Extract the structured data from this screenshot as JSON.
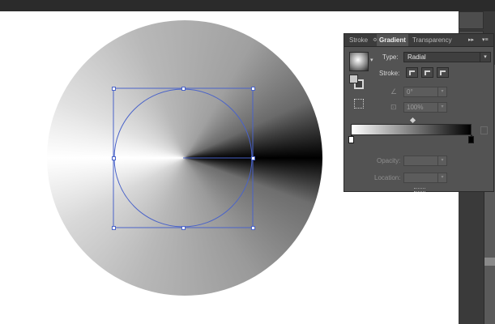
{
  "panel": {
    "tabs": [
      {
        "label": "Stroke"
      },
      {
        "label": "Gradient"
      },
      {
        "label": "Transparency"
      }
    ],
    "tab_double_arrow": "≎",
    "type_label": "Type:",
    "type_value": "Radial",
    "stroke_label": "Stroke:",
    "angle_value": "0°",
    "aspect_value": "100%",
    "opacity_label": "Opacity:",
    "location_label": "Location:",
    "gradient_start_color": "#ffffff",
    "gradient_end_color": "#000000",
    "menu_glyph": "▸▸",
    "menu_lines": "▾≡"
  },
  "canvas": {
    "background": "#ffffff"
  },
  "icons": {
    "gradient_swatch": "radial-gradient-swatch-icon",
    "fill_stroke": "fill-stroke-swap-icon",
    "reverse": "reverse-gradient-icon",
    "angle": "angle-icon",
    "aspect": "aspect-ratio-icon",
    "delete_stop": "trash-icon"
  }
}
